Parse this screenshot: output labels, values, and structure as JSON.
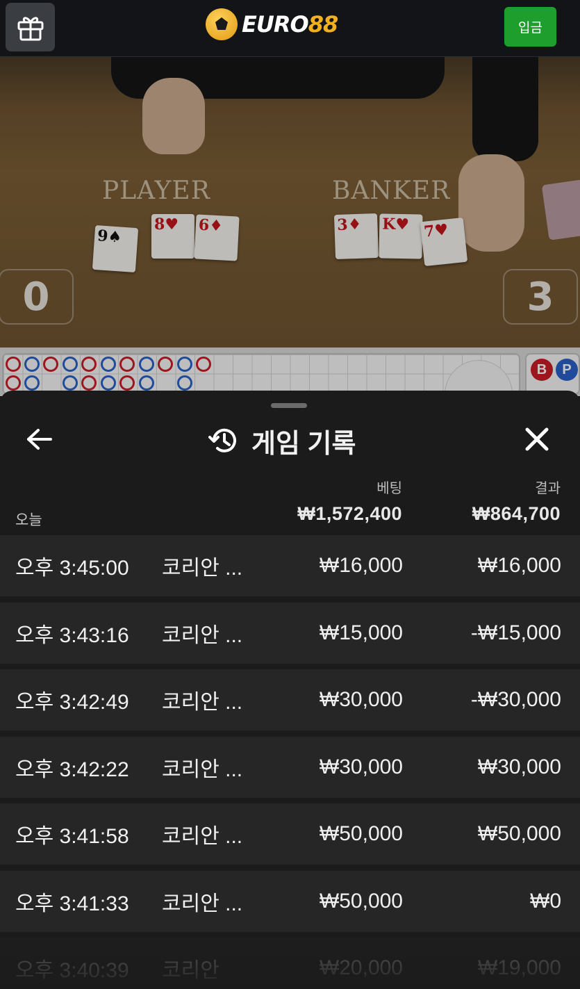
{
  "header": {
    "logo_euro": "EURO",
    "logo_88": "88",
    "deposit_label": "입금"
  },
  "video": {
    "player_label": "PLAYER",
    "banker_label": "BANKER",
    "player_score": "0",
    "banker_score": "3",
    "player_cards": [
      {
        "rank": "9",
        "suit": "♠",
        "color": "black"
      },
      {
        "rank": "8",
        "suit": "♥",
        "color": "red"
      },
      {
        "rank": "6",
        "suit": "♦",
        "color": "red"
      }
    ],
    "banker_cards": [
      {
        "rank": "3",
        "suit": "♦",
        "color": "red"
      },
      {
        "rank": "K",
        "suit": "♥",
        "color": "red"
      },
      {
        "rank": "7",
        "suit": "♥",
        "color": "red"
      }
    ]
  },
  "roadmap": {
    "banker_short": "B",
    "player_short": "P"
  },
  "sheet": {
    "title": "게임 기록",
    "bet_header": "베팅",
    "result_header": "결과",
    "today_label": "오늘",
    "total_bet": "₩1,572,400",
    "total_result": "₩864,700",
    "rows": [
      {
        "time": "오후 3:45:00",
        "game": "코리안 ...",
        "bet": "₩16,000",
        "result": "₩16,000"
      },
      {
        "time": "오후 3:43:16",
        "game": "코리안 ...",
        "bet": "₩15,000",
        "result": "-₩15,000"
      },
      {
        "time": "오후 3:42:49",
        "game": "코리안 ...",
        "bet": "₩30,000",
        "result": "-₩30,000"
      },
      {
        "time": "오후 3:42:22",
        "game": "코리안 ...",
        "bet": "₩30,000",
        "result": "₩30,000"
      },
      {
        "time": "오후 3:41:58",
        "game": "코리안 ...",
        "bet": "₩50,000",
        "result": "₩50,000"
      },
      {
        "time": "오후 3:41:33",
        "game": "코리안 ...",
        "bet": "₩50,000",
        "result": "₩0"
      },
      {
        "time": "오후 3:40:39",
        "game": "코리안",
        "bet": "₩20,000",
        "result": "₩19,000"
      }
    ]
  },
  "colors": {
    "deposit_green": "#1e9e2d",
    "banker_red": "#c91d27",
    "player_blue": "#2a60c7",
    "logo_gold": "#f2b01e"
  }
}
